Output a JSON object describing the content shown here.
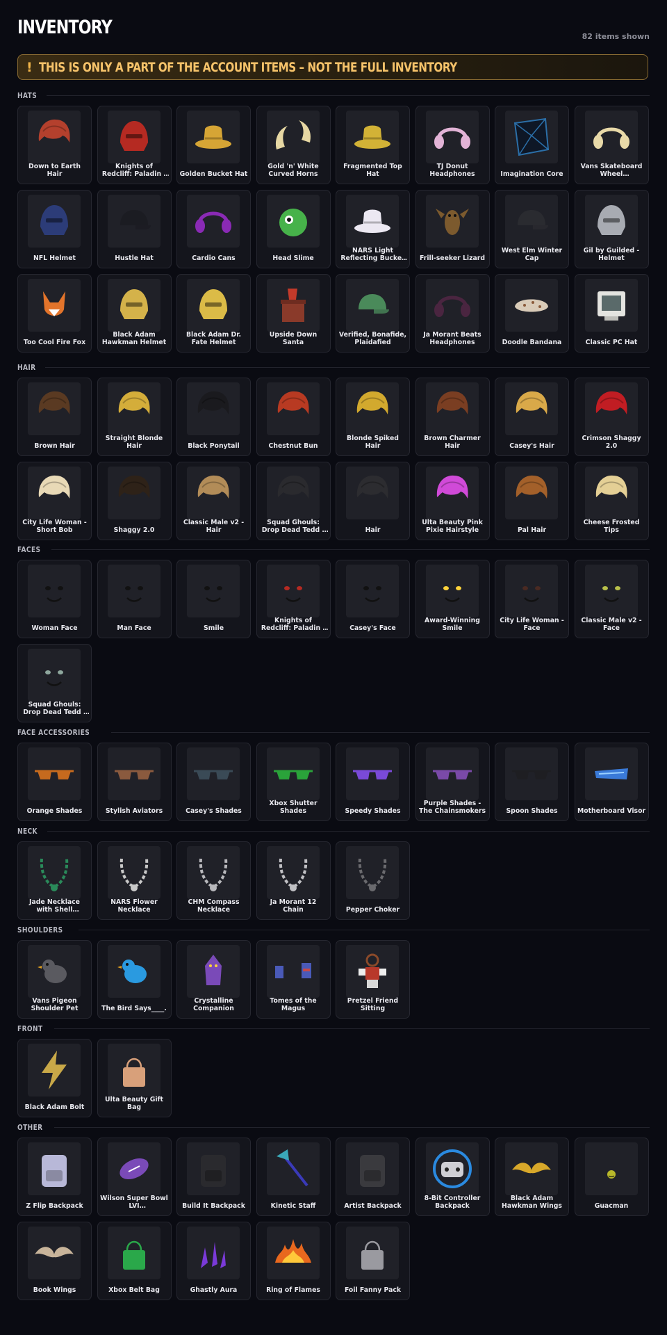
{
  "header": {
    "title": "INVENTORY",
    "count": "82 items shown"
  },
  "warning": {
    "icon": "exclamation-icon",
    "text": "THIS IS ONLY A PART OF THE ACCOUNT ITEMS – NOT THE FULL INVENTORY"
  },
  "sections": [
    {
      "title": "HATS",
      "items": [
        {
          "name": "Down to Earth Hair",
          "icon": "hair-icon",
          "color": "#b4402d"
        },
        {
          "name": "Knights of Redcliff: Paladin - Helmet",
          "icon": "helmet-icon",
          "color": "#b52a22"
        },
        {
          "name": "Golden Bucket Hat",
          "icon": "hat-icon",
          "color": "#d6a535"
        },
        {
          "name": "Gold 'n' White Curved Horns",
          "icon": "horns-icon",
          "color": "#e6d7a3"
        },
        {
          "name": "Fragmented Top Hat",
          "icon": "hat-icon",
          "color": "#d2b236"
        },
        {
          "name": "TJ Donut Headphones",
          "icon": "headphones-icon",
          "color": "#e2b3d6"
        },
        {
          "name": "Imagination Core",
          "icon": "cube-icon",
          "color": "#2b6fa8"
        },
        {
          "name": "Vans Skateboard Wheel Headphones",
          "icon": "headphones-icon",
          "color": "#e8d9a8"
        },
        {
          "name": "NFL Helmet",
          "icon": "helmet-icon",
          "color": "#2c3c78"
        },
        {
          "name": "Hustle Hat",
          "icon": "cap-icon",
          "color": "#1b1c22"
        },
        {
          "name": "Cardio Cans",
          "icon": "headphones-icon",
          "color": "#8a2ab5"
        },
        {
          "name": "Head Slime",
          "icon": "slime-icon",
          "color": "#47b24a"
        },
        {
          "name": "NARS Light Reflecting Bucket Hat",
          "icon": "hat-icon",
          "color": "#ece8f2"
        },
        {
          "name": "Frill-seeker Lizard",
          "icon": "lizard-icon",
          "color": "#7c5a2e"
        },
        {
          "name": "West Elm Winter Cap",
          "icon": "cap-icon",
          "color": "#2a2b30"
        },
        {
          "name": "Gil by Guilded - Helmet",
          "icon": "helmet-icon",
          "color": "#a8abb2"
        },
        {
          "name": "Too Cool Fire Fox",
          "icon": "fox-icon",
          "color": "#e3742b"
        },
        {
          "name": "Black Adam Hawkman Helmet",
          "icon": "helmet-icon",
          "color": "#d4b24a"
        },
        {
          "name": "Black Adam Dr. Fate Helmet",
          "icon": "helmet-icon",
          "color": "#dbbb47"
        },
        {
          "name": "Upside Down Santa",
          "icon": "chimney-icon",
          "color": "#8a3a2a"
        },
        {
          "name": "Verified, Bonafide, Plaidafied",
          "icon": "cap-icon",
          "color": "#4a8a5a"
        },
        {
          "name": "Ja Morant Beats Headphones",
          "icon": "headphones-icon",
          "color": "#4a2540"
        },
        {
          "name": "Doodle Bandana",
          "icon": "bandana-icon",
          "color": "#d9cbb8"
        },
        {
          "name": "Classic PC Hat",
          "icon": "computer-icon",
          "color": "#e4e4e0"
        }
      ]
    },
    {
      "title": "HAIR",
      "items": [
        {
          "name": "Brown Hair",
          "icon": "hair-icon",
          "color": "#5a3a22"
        },
        {
          "name": "Straight Blonde Hair",
          "icon": "hair-icon",
          "color": "#d4ad3a"
        },
        {
          "name": "Black Ponytail",
          "icon": "hair-icon",
          "color": "#1a1a1e"
        },
        {
          "name": "Chestnut Bun",
          "icon": "hair-icon",
          "color": "#b83a22"
        },
        {
          "name": "Blonde Spiked Hair",
          "icon": "hair-icon",
          "color": "#d2a92e"
        },
        {
          "name": "Brown Charmer Hair",
          "icon": "hair-icon",
          "color": "#7a3e22"
        },
        {
          "name": "Casey's Hair",
          "icon": "hair-icon",
          "color": "#d9a949"
        },
        {
          "name": "Crimson Shaggy 2.0",
          "icon": "hair-icon",
          "color": "#c11d23"
        },
        {
          "name": "City Life Woman - Short Bob",
          "icon": "hair-icon",
          "color": "#e8d9b6"
        },
        {
          "name": "Shaggy 2.0",
          "icon": "hair-icon",
          "color": "#2e2218"
        },
        {
          "name": "Classic Male v2 - Hair",
          "icon": "hair-icon",
          "color": "#b28c58"
        },
        {
          "name": "Squad Ghouls: Drop Dead Tedd - Hair",
          "icon": "hair-icon",
          "color": "#2a2a2e"
        },
        {
          "name": "Hair",
          "icon": "hair-icon",
          "color": "#2c2c30"
        },
        {
          "name": "Ulta Beauty Pink Pixie Hairstyle",
          "icon": "hair-icon",
          "color": "#d04ad8"
        },
        {
          "name": "Pal Hair",
          "icon": "hair-icon",
          "color": "#a3602a"
        },
        {
          "name": "Cheese Frosted Tips",
          "icon": "hair-icon",
          "color": "#e4cf95"
        }
      ]
    },
    {
      "title": "FACES",
      "items": [
        {
          "name": "Woman Face",
          "icon": "face-icon",
          "color": "#111111"
        },
        {
          "name": "Man Face",
          "icon": "face-icon",
          "color": "#111111"
        },
        {
          "name": "Smile",
          "icon": "face-icon",
          "color": "#111111"
        },
        {
          "name": "Knights of Redcliff: Paladin - Face",
          "icon": "face-icon",
          "color": "#b52a22"
        },
        {
          "name": "Casey's Face",
          "icon": "face-icon",
          "color": "#111111"
        },
        {
          "name": "Award-Winning Smile",
          "icon": "face-icon",
          "color": "#ffd33a"
        },
        {
          "name": "City Life Woman - Face",
          "icon": "face-icon",
          "color": "#4a2a22"
        },
        {
          "name": "Classic Male v2 - Face",
          "icon": "face-icon",
          "color": "#b8c04a"
        },
        {
          "name": "Squad Ghouls: Drop Dead Tedd - Zombie Face",
          "icon": "face-icon",
          "color": "#8ea79d"
        }
      ]
    },
    {
      "title": "FACE ACCESSORIES",
      "items": [
        {
          "name": "Orange Shades",
          "icon": "glasses-icon",
          "color": "#c66a1e"
        },
        {
          "name": "Stylish Aviators",
          "icon": "glasses-icon",
          "color": "#8a5a3e"
        },
        {
          "name": "Casey's Shades",
          "icon": "glasses-icon",
          "color": "#3a4a56"
        },
        {
          "name": "Xbox Shutter Shades",
          "icon": "glasses-icon",
          "color": "#2aa33a"
        },
        {
          "name": "Speedy Shades",
          "icon": "glasses-icon",
          "color": "#7a4ad8"
        },
        {
          "name": "Purple Shades - The Chainsmokers",
          "icon": "glasses-icon",
          "color": "#7a4aa8"
        },
        {
          "name": "Spoon Shades",
          "icon": "glasses-icon",
          "color": "#1e1e22"
        },
        {
          "name": "Motherboard Visor",
          "icon": "visor-icon",
          "color": "#3a7ad8"
        }
      ]
    },
    {
      "title": "NECK",
      "items": [
        {
          "name": "Jade Necklace with Shell Pendant",
          "icon": "necklace-icon",
          "color": "#2a8a5a"
        },
        {
          "name": "NARS Flower Necklace",
          "icon": "necklace-icon",
          "color": "#c8c8c8"
        },
        {
          "name": "CHM Compass Necklace",
          "icon": "necklace-icon",
          "color": "#b8b8bc"
        },
        {
          "name": "Ja Morant 12 Chain",
          "icon": "necklace-icon",
          "color": "#c0c0c4"
        },
        {
          "name": "Pepper Choker",
          "icon": "necklace-icon",
          "color": "#6a6a6e"
        }
      ]
    },
    {
      "title": "SHOULDERS",
      "items": [
        {
          "name": "Vans Pigeon Shoulder Pet",
          "icon": "bird-icon",
          "color": "#5a5a60"
        },
        {
          "name": "The Bird Says____.",
          "icon": "bird-icon",
          "color": "#2a9ae0"
        },
        {
          "name": "Crystalline Companion",
          "icon": "creature-icon",
          "color": "#7a4ab8"
        },
        {
          "name": "Tomes of the Magus",
          "icon": "book-icon",
          "color": "#4a5ab8"
        },
        {
          "name": "Pretzel Friend Sitting",
          "icon": "pretzel-icon",
          "color": "#b8382a"
        }
      ]
    },
    {
      "title": "FRONT",
      "items": [
        {
          "name": "Black Adam Bolt",
          "icon": "bolt-icon",
          "color": "#c8a848"
        },
        {
          "name": "Ulta Beauty Gift Bag",
          "icon": "bag-icon",
          "color": "#d8a07a"
        }
      ]
    },
    {
      "title": "OTHER",
      "items": [
        {
          "name": "Z Flip Backpack",
          "icon": "backpack-icon",
          "color": "#b8b8d8"
        },
        {
          "name": "Wilson Super Bowl LVI Commemorative Football",
          "icon": "football-icon",
          "color": "#7a4ab8"
        },
        {
          "name": "Build It Backpack",
          "icon": "backpack-icon",
          "color": "#2a2a2e"
        },
        {
          "name": "Kinetic Staff",
          "icon": "staff-icon",
          "color": "#3aa8b8"
        },
        {
          "name": "Artist Backpack",
          "icon": "backpack-icon",
          "color": "#3a3a3e"
        },
        {
          "name": "8-Bit Controller Backpack",
          "icon": "controller-icon",
          "color": "#2a8ae0"
        },
        {
          "name": "Black Adam Hawkman Wings",
          "icon": "wings-icon",
          "color": "#d8a82a"
        },
        {
          "name": "Guacman",
          "icon": "guacman-icon",
          "color": "#b8b82a"
        },
        {
          "name": "Book Wings",
          "icon": "wings-icon",
          "color": "#c8b49a"
        },
        {
          "name": "Xbox Belt Bag",
          "icon": "bag-icon",
          "color": "#2aa84a"
        },
        {
          "name": "Ghastly Aura",
          "icon": "aura-icon",
          "color": "#7a3ad8"
        },
        {
          "name": "Ring of Flames",
          "icon": "flame-icon",
          "color": "#e8681e"
        },
        {
          "name": "Foil Fanny Pack",
          "icon": "bag-icon",
          "color": "#9a9aa0"
        }
      ]
    }
  ]
}
